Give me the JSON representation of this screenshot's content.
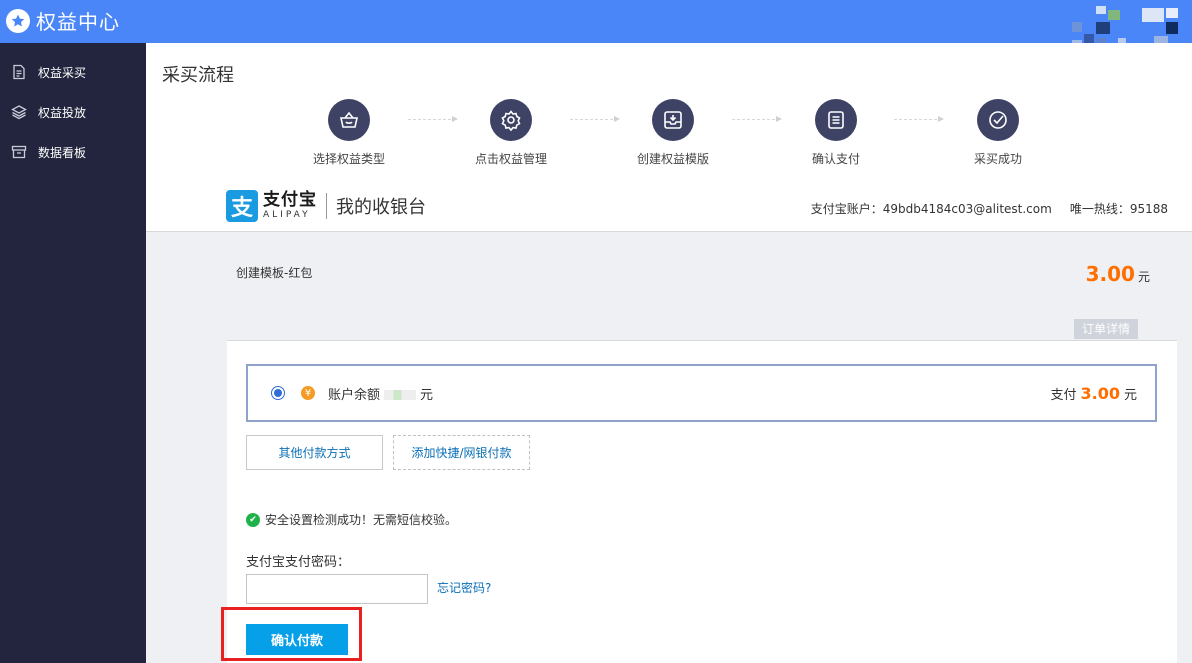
{
  "app": {
    "title": "权益中心"
  },
  "sidebar": {
    "items": [
      {
        "label": "权益采买",
        "icon": "document-icon"
      },
      {
        "label": "权益投放",
        "icon": "layers-icon"
      },
      {
        "label": "数据看板",
        "icon": "archive-box-icon"
      }
    ]
  },
  "page": {
    "title": "采买流程"
  },
  "steps": [
    {
      "label": "选择权益类型",
      "icon": "basket-icon"
    },
    {
      "label": "点击权益管理",
      "icon": "gear-icon"
    },
    {
      "label": "创建权益模版",
      "icon": "inbox-download-icon"
    },
    {
      "label": "确认支付",
      "icon": "list-document-icon"
    },
    {
      "label": "采买成功",
      "icon": "check-circle-icon"
    }
  ],
  "alipay": {
    "logo_cn": "支付宝",
    "logo_en": "ALIPAY",
    "cashier_title": "我的收银台",
    "account_label": "支付宝账户：49bdb4184c03@alitest.com",
    "hotline_label": "唯一热线：95188"
  },
  "order": {
    "name": "创建模板-红包",
    "amount": "3.00",
    "currency": "元",
    "detail_tab": "订单详情"
  },
  "payment": {
    "balance_label": "账户余额",
    "balance_unit": "元",
    "pay_prefix": "支付",
    "pay_amount": "3.00",
    "pay_unit": "元",
    "other_methods": "其他付款方式",
    "add_card": "添加快捷/网银付款",
    "security_msg": "安全设置检测成功！无需短信校验。",
    "password_label": "支付宝支付密码：",
    "forgot_password": "忘记密码?",
    "confirm_button": "确认付款"
  },
  "colors": {
    "topbar": "#4a86f7",
    "sidebar": "#22253d",
    "step_circle": "#3e4365",
    "amount": "#ff6e00",
    "confirm_button": "#05a0e8",
    "highlight_outline": "#e82020"
  }
}
